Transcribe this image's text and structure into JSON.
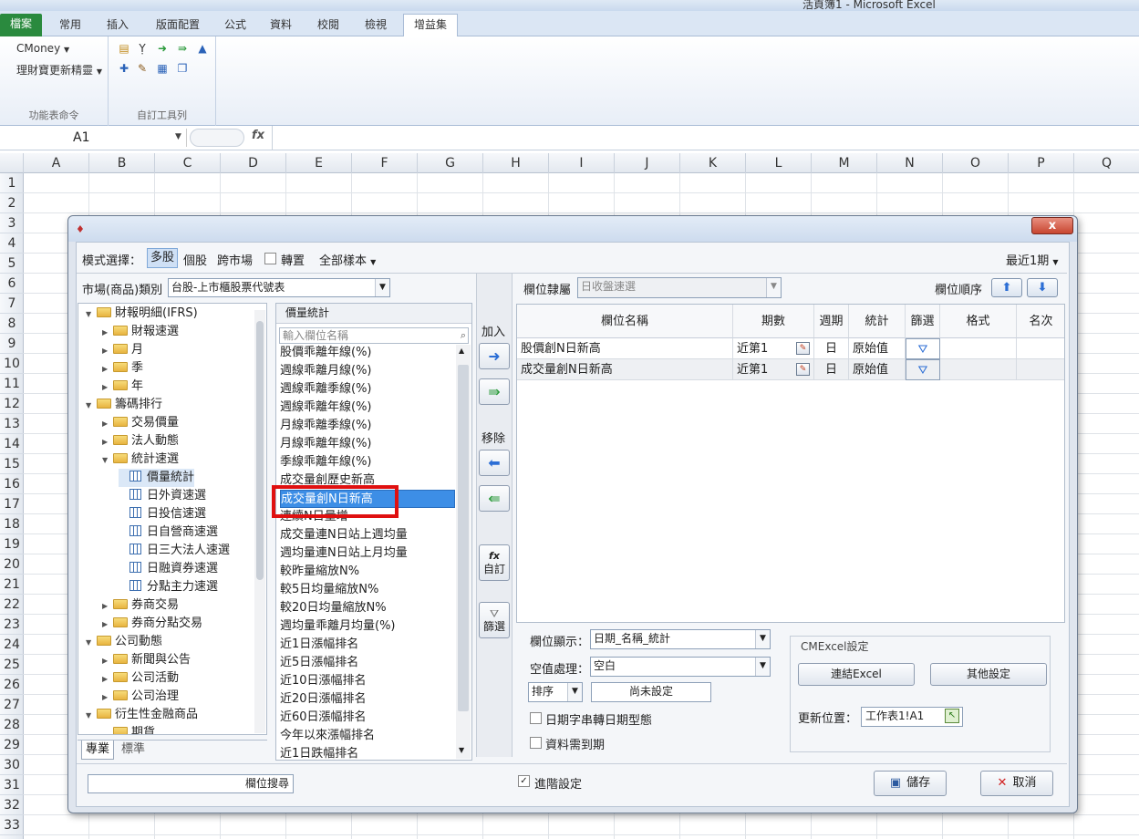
{
  "window": {
    "title": "活頁簿1 - Microsoft Excel"
  },
  "ribbon": {
    "tabs": [
      "檔案",
      "常用",
      "插入",
      "版面配置",
      "公式",
      "資料",
      "校閱",
      "檢視",
      "增益集"
    ],
    "menus": [
      "CMoney",
      "理財寶更新精靈"
    ],
    "groups": [
      "功能表命令",
      "自訂工具列"
    ]
  },
  "formula_bar": {
    "name_box": "A1",
    "fx": "fx"
  },
  "sheet": {
    "columns": [
      "A",
      "B",
      "C",
      "D",
      "E",
      "F",
      "G",
      "H",
      "I",
      "J",
      "K",
      "L",
      "M",
      "N",
      "O",
      "P",
      "Q"
    ],
    "rows": [
      "1",
      "2",
      "3",
      "4",
      "5",
      "6",
      "7",
      "8",
      "9",
      "10",
      "11",
      "12",
      "13",
      "14",
      "15",
      "16",
      "17",
      "18",
      "19",
      "20",
      "21",
      "22",
      "23",
      "24",
      "25",
      "26",
      "27",
      "28",
      "29",
      "30",
      "31",
      "32",
      "33"
    ]
  },
  "dialog": {
    "close": "x",
    "mode_label": "模式選擇：",
    "mode_options": [
      "多股",
      "個股",
      "跨市場"
    ],
    "transpose_label": "轉置",
    "sample_label": "全部樣本",
    "recent_label": "最近1期",
    "market_label": "市場(商品)類別",
    "market_value": "台股-上市櫃股票代號表",
    "tree": [
      {
        "label": "財報明細(IFRS)",
        "level": 0,
        "type": "folder",
        "toggle": "▼"
      },
      {
        "label": "財報速選",
        "level": 1,
        "type": "folder",
        "toggle": "▶"
      },
      {
        "label": "月",
        "level": 1,
        "type": "folder",
        "toggle": "▶"
      },
      {
        "label": "季",
        "level": 1,
        "type": "folder",
        "toggle": "▶"
      },
      {
        "label": "年",
        "level": 1,
        "type": "folder",
        "toggle": "▶"
      },
      {
        "label": "籌碼排行",
        "level": 0,
        "type": "folder",
        "toggle": "▼"
      },
      {
        "label": "交易價量",
        "level": 1,
        "type": "folder",
        "toggle": "▶"
      },
      {
        "label": "法人動態",
        "level": 1,
        "type": "folder",
        "toggle": "▶"
      },
      {
        "label": "統計速選",
        "level": 1,
        "type": "folder",
        "toggle": "▼"
      },
      {
        "label": "價量統計",
        "level": 2,
        "type": "table",
        "toggle": ""
      },
      {
        "label": "日外資速選",
        "level": 2,
        "type": "table",
        "toggle": ""
      },
      {
        "label": "日投信速選",
        "level": 2,
        "type": "table",
        "toggle": ""
      },
      {
        "label": "日自營商速選",
        "level": 2,
        "type": "table",
        "toggle": ""
      },
      {
        "label": "日三大法人速選",
        "level": 2,
        "type": "table",
        "toggle": ""
      },
      {
        "label": "日融資券速選",
        "level": 2,
        "type": "table",
        "toggle": ""
      },
      {
        "label": "分點主力速選",
        "level": 2,
        "type": "table",
        "toggle": ""
      },
      {
        "label": "券商交易",
        "level": 1,
        "type": "folder",
        "toggle": "▶"
      },
      {
        "label": "券商分點交易",
        "level": 1,
        "type": "folder",
        "toggle": "▶"
      },
      {
        "label": "公司動態",
        "level": 0,
        "type": "folder",
        "toggle": "▼"
      },
      {
        "label": "新聞與公告",
        "level": 1,
        "type": "folder",
        "toggle": "▶"
      },
      {
        "label": "公司活動",
        "level": 1,
        "type": "folder",
        "toggle": "▶"
      },
      {
        "label": "公司治理",
        "level": 1,
        "type": "folder",
        "toggle": "▶"
      },
      {
        "label": "衍生性金融商品",
        "level": 0,
        "type": "folder",
        "toggle": "▼"
      },
      {
        "label": "期貨",
        "level": 1,
        "type": "folder",
        "toggle": ""
      }
    ],
    "tree_tabs": [
      "專業",
      "標準"
    ],
    "field_header": "價量統計",
    "field_search_placeholder": "輸入欄位名稱",
    "fields": [
      "股價乖離年線(%)",
      "週線乖離月線(%)",
      "週線乖離季線(%)",
      "週線乖離年線(%)",
      "月線乖離季線(%)",
      "月線乖離年線(%)",
      "季線乖離年線(%)",
      "成交量創歷史新高",
      "成交量創N日新高",
      "連續N日量增",
      "成交量連N日站上週均量",
      "週均量連N日站上月均量",
      "較昨量縮放N%",
      "較5日均量縮放N%",
      "較20日均量縮放N%",
      "週均量乖離月均量(%)",
      "近1日漲幅排名",
      "近5日漲幅排名",
      "近10日漲幅排名",
      "近20日漲幅排名",
      "近60日漲幅排名",
      "今年以來漲幅排名",
      "近1日跌幅排名"
    ],
    "selected_field": "成交量創N日新高",
    "add_label": "加入",
    "remove_label": "移除",
    "custom_label": "自訂",
    "filter_label": "篩選",
    "fx_glyph": "fx",
    "field_group_label": "欄位隸屬",
    "field_group_value": "日收盤速選",
    "order_label": "欄位順序",
    "grid_headers": [
      "欄位名稱",
      "期數",
      "週期",
      "統計",
      "篩選",
      "格式",
      "名次"
    ],
    "grid_rows": [
      {
        "name": "股價創N日新高",
        "period": "近第1",
        "cycle": "日",
        "stat": "原始值"
      },
      {
        "name": "成交量創N日新高",
        "period": "近第1",
        "cycle": "日",
        "stat": "原始值"
      }
    ],
    "display_label": "欄位顯示：",
    "display_value": "日期_名稱_統計",
    "null_label": "空值處理：",
    "null_value": "空白",
    "sort_label": "排序",
    "sort_status": "尚未設定",
    "date_string_label": "日期字串轉日期型態",
    "to_date_label": "資料需到期",
    "cmexcel_title": "CMExcel設定",
    "link_excel_label": "連結Excel",
    "other_settings_label": "其他設定",
    "update_pos_label": "更新位置：",
    "update_pos_value": "工作表1!A1",
    "advanced_label": "進階設定",
    "field_search_button": "欄位搜尋",
    "save_label": "儲存",
    "cancel_label": "取消"
  }
}
